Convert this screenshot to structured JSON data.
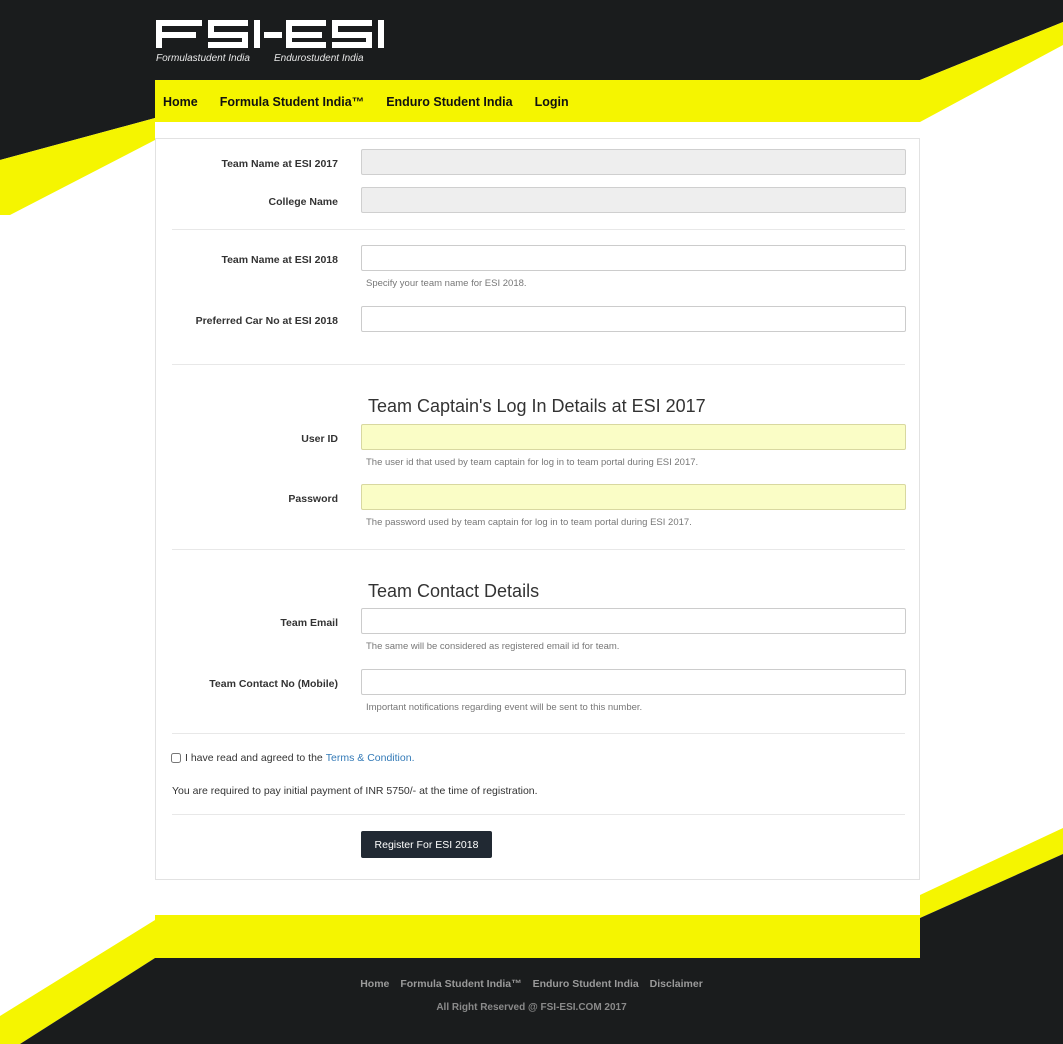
{
  "brand": {
    "logo_text": "FSI-ESI",
    "sub_left": "Formulastudent India",
    "sub_right": "Endurostudent India",
    "colors": {
      "yellow": "#f5f500",
      "dark": "#1a1c1d",
      "button": "#212933"
    }
  },
  "nav": {
    "items": [
      "Home",
      "Formula Student India™",
      "Enduro Student India",
      "Login"
    ]
  },
  "form": {
    "team_name_2017": {
      "label": "Team Name at ESI 2017",
      "value": ""
    },
    "college_name": {
      "label": "College Name",
      "value": ""
    },
    "team_name_2018": {
      "label": "Team Name at ESI 2018",
      "value": "",
      "help": "Specify your team name for ESI 2018."
    },
    "car_no_2018": {
      "label": "Preferred Car No at ESI 2018",
      "value": ""
    },
    "section_login": "Team Captain's Log In Details at ESI 2017",
    "user_id": {
      "label": "User ID",
      "value": "",
      "help": "The user id that used by team captain for log in to team portal during ESI 2017."
    },
    "password": {
      "label": "Password",
      "value": "",
      "help": "The password used by team captain for log in to team portal during ESI 2017."
    },
    "section_contact": "Team Contact Details",
    "team_email": {
      "label": "Team Email",
      "value": "",
      "help": "The same will be considered as registered email id for team."
    },
    "team_contact": {
      "label": "Team Contact No (Mobile)",
      "value": "",
      "help": "Important notifications regarding event will be sent to this number."
    },
    "agree_text": "I have read and agreed to the",
    "terms_link": "Terms & Condition.",
    "agree_checked": false,
    "payment_note": "You are required to pay initial payment of INR 5750/- at the time of registration.",
    "submit_label": "Register For ESI 2018"
  },
  "footer": {
    "links": [
      "Home",
      "Formula Student India™",
      "Enduro Student India",
      "Disclaimer"
    ],
    "copyright": "All Right Reserved @ FSI-ESI.COM 2017"
  }
}
